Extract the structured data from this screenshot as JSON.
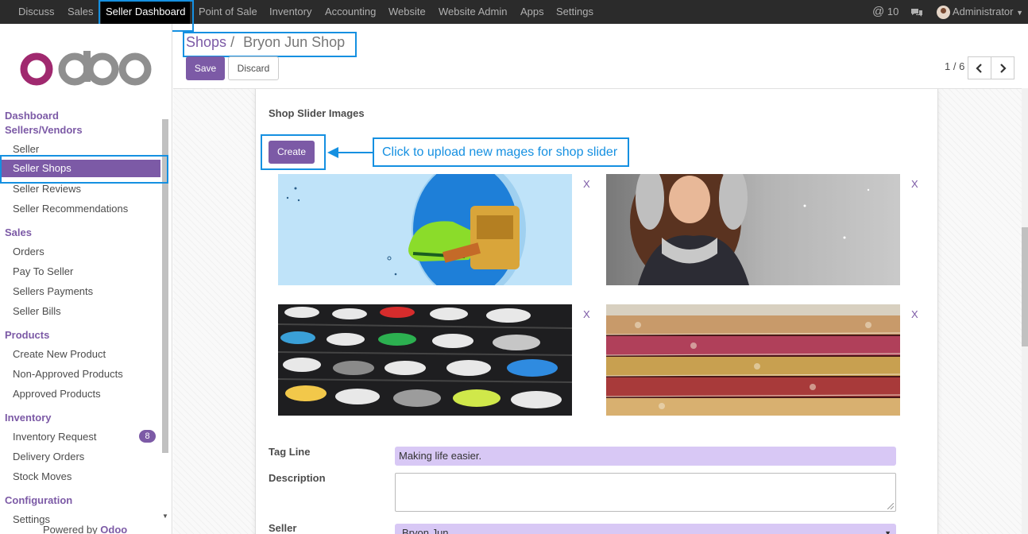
{
  "topnav": {
    "items": [
      "Discuss",
      "Sales",
      "Seller Dashboard",
      "Point of Sale",
      "Inventory",
      "Accounting",
      "Website",
      "Website Admin",
      "Apps",
      "Settings"
    ],
    "active": "Seller Dashboard",
    "mentions": "10",
    "user": "Administrator"
  },
  "sidebar": {
    "sections": [
      {
        "title": "Dashboard",
        "items": []
      },
      {
        "title": "Sellers/Vendors",
        "items": [
          "Seller",
          "Seller Shops",
          "Seller Reviews",
          "Seller Recommendations"
        ]
      },
      {
        "title": "Sales",
        "items": [
          "Orders",
          "Pay To Seller",
          "Sellers Payments",
          "Seller Bills"
        ]
      },
      {
        "title": "Products",
        "items": [
          "Create New Product",
          "Non-Approved Products",
          "Approved Products"
        ]
      },
      {
        "title": "Inventory",
        "items": [
          "Inventory Request",
          "Delivery Orders",
          "Stock Moves"
        ]
      },
      {
        "title": "Configuration",
        "items": [
          "Settings"
        ]
      }
    ],
    "active_item": "Seller Shops",
    "inventory_request_badge": "8",
    "powered_by": "Powered by",
    "powered_brand": "Odoo"
  },
  "control": {
    "breadcrumb_parent": "Shops",
    "breadcrumb_sep": "/",
    "breadcrumb_current": "Bryon Jun Shop",
    "save_label": "Save",
    "discard_label": "Discard",
    "pager": "1 / 6"
  },
  "form": {
    "slider_title": "Shop Slider Images",
    "create_label": "Create",
    "remove_label": "X",
    "callout": "Click to upload new mages for shop slider",
    "tag_line_label": "Tag Line",
    "tag_line_value": "Making life easier.",
    "description_label": "Description",
    "seller_label": "Seller",
    "seller_value": "Bryon Jun"
  },
  "colors": {
    "brand": "#7c5aa6",
    "highlight": "#1590e1",
    "navbar": "#2b2b2b"
  }
}
